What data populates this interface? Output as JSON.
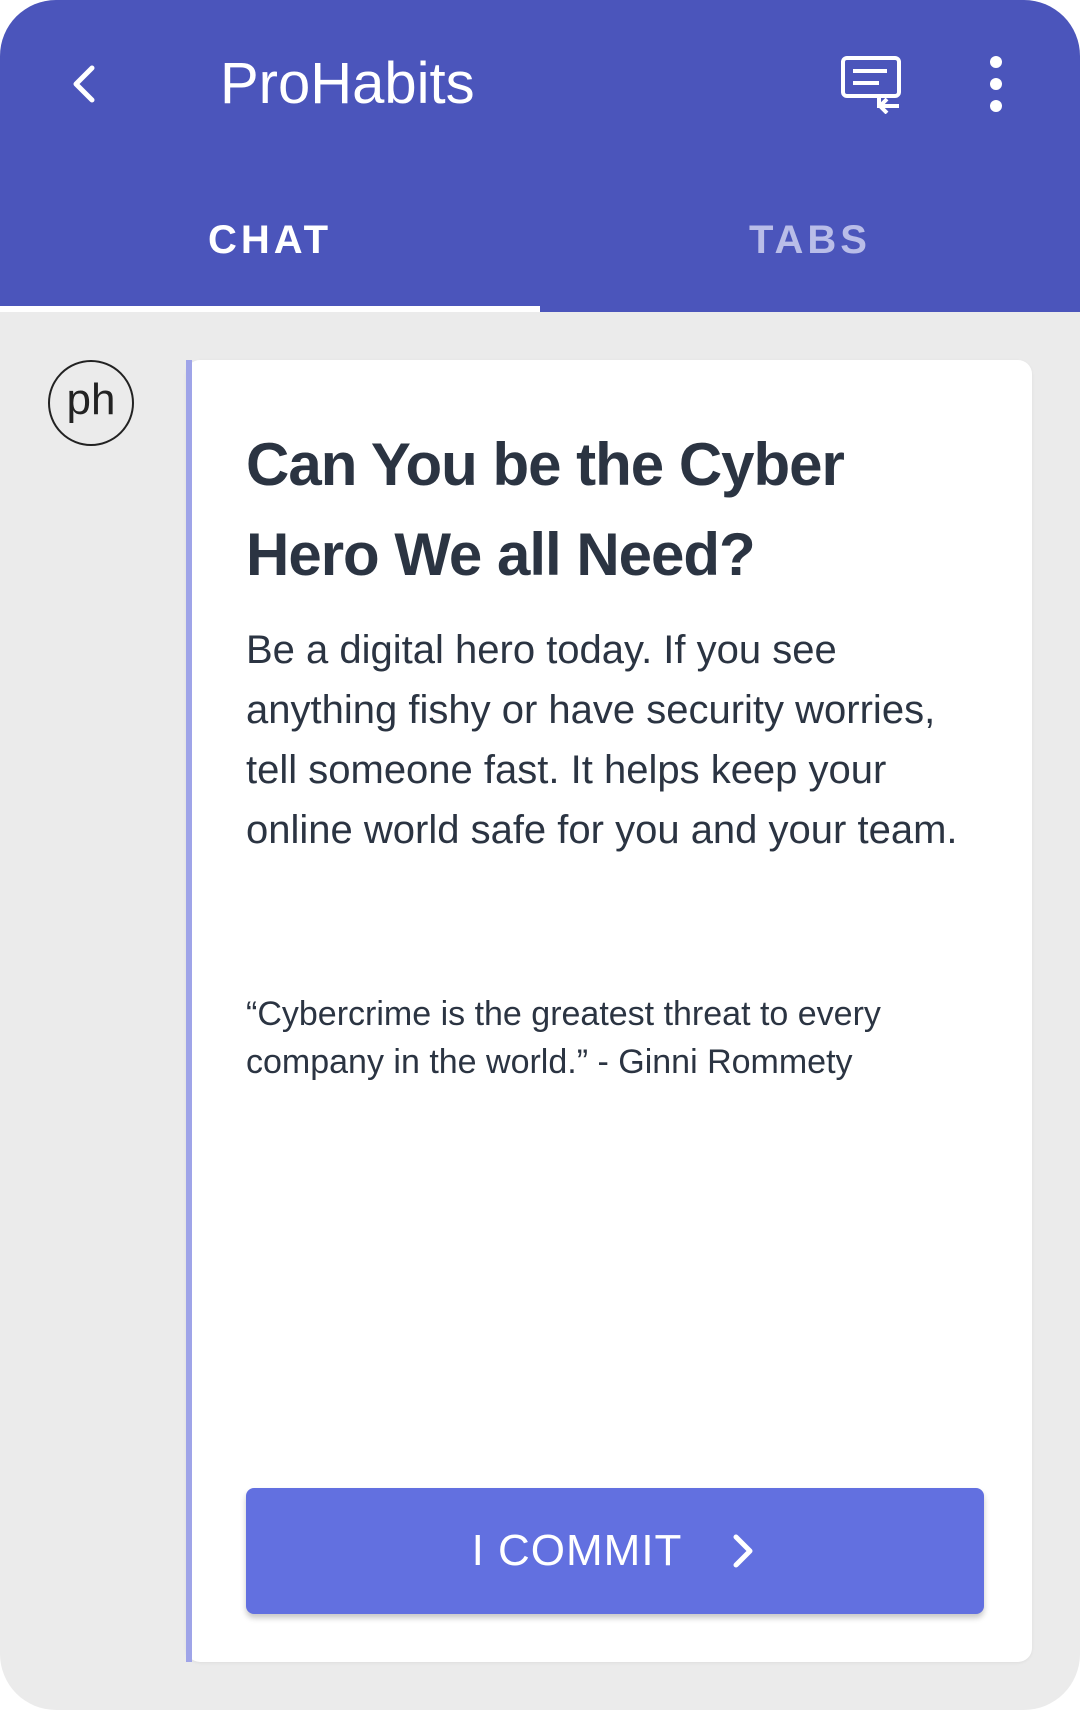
{
  "app_bar": {
    "title": "ProHabits",
    "background_color": "#4b55bb",
    "back_icon": "chevron-left-icon",
    "chat_icon": "chat-transfer-icon",
    "menu_icon": "more-vertical-icon"
  },
  "tabs": [
    {
      "label": "CHAT",
      "selected": true
    },
    {
      "label": "TABS",
      "selected": false
    }
  ],
  "message": {
    "avatar_text": "ph",
    "title": "Can You be the Cyber Hero We all Need?",
    "body": "Be a digital hero today. If you see anything fishy or have security worries, tell someone fast. It helps keep your online world safe for you and your team.",
    "quote": "“Cybercrime is the greatest threat to every company in the world.” - Ginni Rommety",
    "accent_color": "#9fa4e8",
    "button": {
      "label": "I COMMIT",
      "icon": "chevron-right-icon",
      "color": "#6270e0"
    }
  }
}
